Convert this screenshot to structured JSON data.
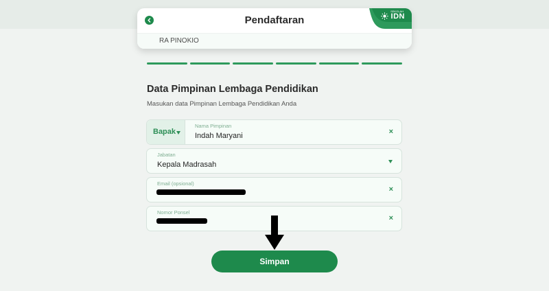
{
  "header": {
    "title": "Pendaftaran",
    "subtitle": "RA PINOKIO",
    "brand_text": "IDN",
    "brand_small": "SEKOLAH"
  },
  "progress": {
    "steps_total": 6,
    "steps_done": 6
  },
  "section": {
    "title": "Data Pimpinan Lembaga Pendidikan",
    "subtitle": "Masukan data Pimpinan Lembaga Pendidikan Anda"
  },
  "form": {
    "name_field": {
      "prefix": "Bapak",
      "label": "Nama Pimpinan",
      "value": "Indah Maryani",
      "clear": "×"
    },
    "position_field": {
      "label": "Jabatan",
      "value": "Kepala Madrasah"
    },
    "email_field": {
      "label": "Email (opsional)",
      "value": "",
      "clear": "×"
    },
    "phone_field": {
      "label": "Nomor Ponsel",
      "value": "",
      "clear": "×"
    }
  },
  "submit": {
    "label": "Simpan"
  },
  "colors": {
    "primary": "#1e8a4c",
    "accent": "#2e9a5c"
  }
}
